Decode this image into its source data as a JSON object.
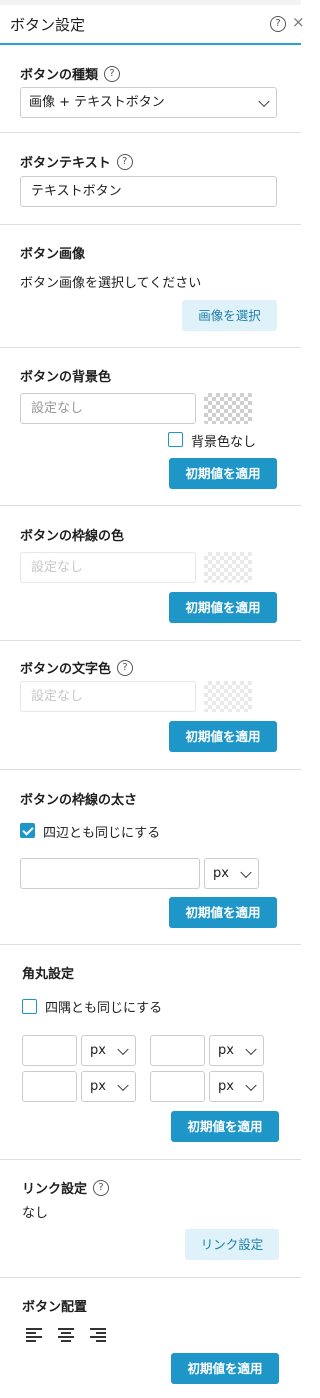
{
  "header": {
    "title": "ボタン設定",
    "help": "?",
    "close": "×"
  },
  "button_type": {
    "label": "ボタンの種類",
    "value": "画像 + テキストボタン"
  },
  "button_text": {
    "label": "ボタンテキスト",
    "value": "テキストボタン"
  },
  "button_image": {
    "label": "ボタン画像",
    "prompt": "ボタン画像を選択してください",
    "select_label": "画像を選択"
  },
  "bg_color": {
    "label": "ボタンの背景色",
    "placeholder": "設定なし",
    "no_bg_label": "背景色なし",
    "no_bg_checked": false,
    "apply_label": "初期値を適用"
  },
  "border_color": {
    "label": "ボタンの枠線の色",
    "placeholder": "設定なし",
    "apply_label": "初期値を適用"
  },
  "text_color": {
    "label": "ボタンの文字色",
    "placeholder": "設定なし",
    "apply_label": "初期値を適用"
  },
  "border_width": {
    "label": "ボタンの枠線の太さ",
    "same_label": "四辺とも同じにする",
    "same_checked": true,
    "value": "",
    "unit": "px",
    "apply_label": "初期値を適用"
  },
  "corner_radius": {
    "label": "角丸設定",
    "same_label": "四隅とも同じにする",
    "same_checked": false,
    "unit": "px",
    "apply_label": "初期値を適用"
  },
  "link": {
    "label": "リンク設定",
    "value": "なし",
    "button_label": "リンク設定"
  },
  "alignment": {
    "label": "ボタン配置",
    "options": [
      "align-left-icon",
      "align-center-icon",
      "align-right-icon"
    ],
    "apply_label": "初期値を適用"
  }
}
